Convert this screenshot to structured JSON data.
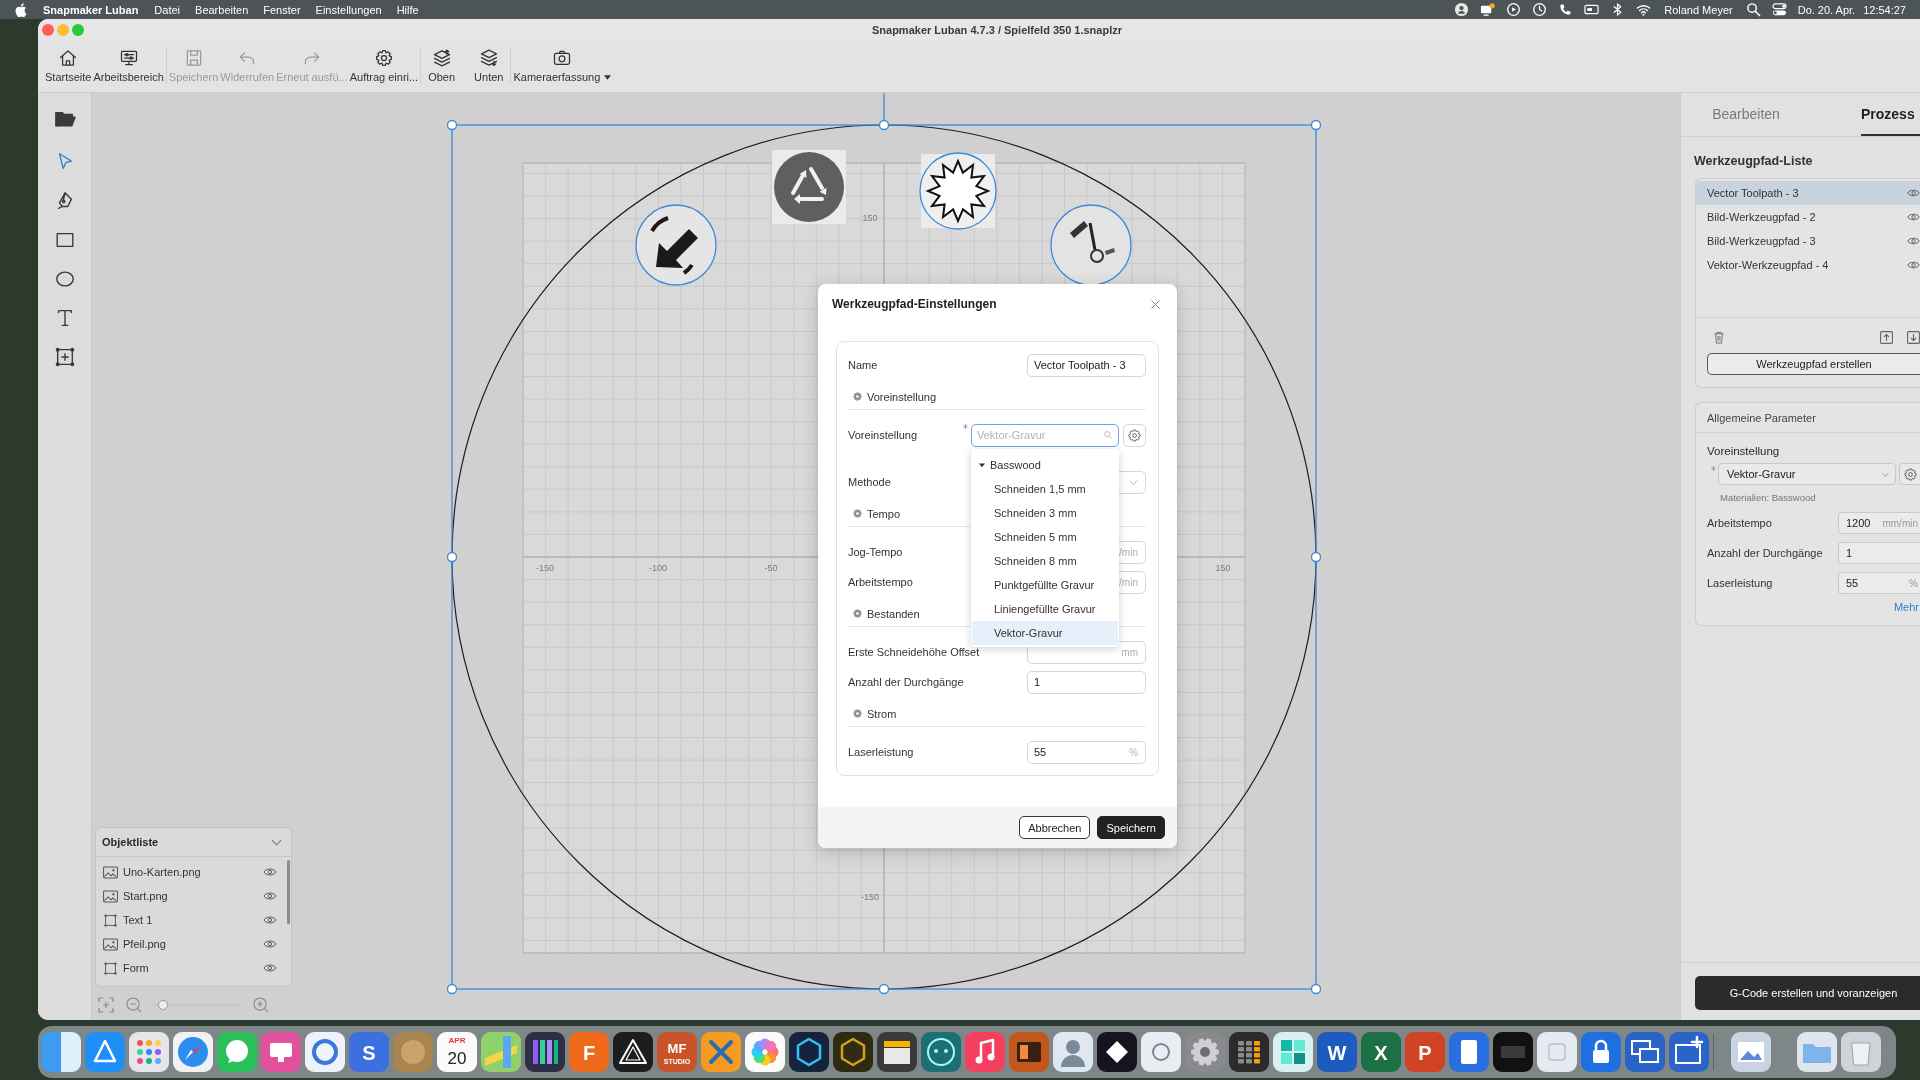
{
  "menu_bar": {
    "app_name": "Snapmaker Luban",
    "menus": [
      "Datei",
      "Bearbeiten",
      "Fenster",
      "Einstellungen",
      "Hilfe"
    ],
    "user": "Roland Meyer",
    "date": "Do. 20. Apr.",
    "time": "12:54:27"
  },
  "window": {
    "title": "Snapmaker Luban 4.7.3 / Spielfeld 350 1.snaplzr"
  },
  "toolbar": {
    "groups": [
      {
        "items": [
          {
            "label": "Startseite",
            "disabled": false,
            "dropdown": false
          },
          {
            "label": "Arbeitsbereich",
            "disabled": false,
            "dropdown": false
          }
        ]
      },
      {
        "items": [
          {
            "label": "Speichern",
            "disabled": true,
            "dropdown": false
          },
          {
            "label": "Widerrufen",
            "disabled": true,
            "dropdown": false
          },
          {
            "label": "Erneut ausfü...",
            "disabled": true,
            "dropdown": false
          },
          {
            "label": "Auftrag einri...",
            "disabled": false,
            "dropdown": false
          }
        ]
      },
      {
        "items": [
          {
            "label": "Oben",
            "disabled": false,
            "dropdown": false
          },
          {
            "label": "Unten",
            "disabled": false,
            "dropdown": false
          }
        ]
      },
      {
        "items": [
          {
            "label": "Kameraerfassung",
            "disabled": false,
            "dropdown": true
          }
        ]
      }
    ]
  },
  "tools": [
    {
      "selected": false
    },
    {
      "selected": true
    },
    {
      "selected": false
    },
    {
      "selected": false
    },
    {
      "selected": false
    },
    {
      "selected": false
    },
    {
      "selected": false
    }
  ],
  "canvas": {
    "x_axis_labels": [
      "-150",
      "-100",
      "-50",
      "150"
    ],
    "y_axis_labels": [
      "150",
      "-150"
    ]
  },
  "object_list": {
    "title": "Objektliste",
    "items": [
      {
        "name": "Uno-Karten.png",
        "kind": "image",
        "visible": true
      },
      {
        "name": "Start.png",
        "kind": "image",
        "visible": true
      },
      {
        "name": "Text 1",
        "kind": "vector",
        "visible": true
      },
      {
        "name": "Pfeil.png",
        "kind": "image",
        "visible": true
      },
      {
        "name": "Form",
        "kind": "vector",
        "visible": true
      }
    ]
  },
  "zoom_bar": {
    "level": 0.05
  },
  "dialog": {
    "title": "Werkzeugpfad-Einstellungen",
    "rows": [
      {
        "kind": "field",
        "label": "Name",
        "value": "Vector Toolpath - 3"
      },
      {
        "kind": "section",
        "label": "Voreinstellung"
      },
      {
        "kind": "preset",
        "label": "Voreinstellung",
        "required": true,
        "placeholder": "Vektor-Gravur"
      },
      {
        "kind": "select",
        "label": "Methode"
      },
      {
        "kind": "section",
        "label": "Tempo"
      },
      {
        "kind": "field",
        "label": "Jog-Tempo",
        "unit": "/min"
      },
      {
        "kind": "field",
        "label": "Arbeitstempo",
        "unit": "/min"
      },
      {
        "kind": "section",
        "label": "Bestanden"
      },
      {
        "kind": "field",
        "label": "Erste Schneidehöhe Offset",
        "unit": "mm"
      },
      {
        "kind": "field",
        "label": "Anzahl der Durchgänge",
        "value": "1"
      },
      {
        "kind": "section",
        "label": "Strom"
      },
      {
        "kind": "field",
        "label": "Laserleistung",
        "value": "55",
        "unit": "%"
      }
    ],
    "dropdown": {
      "group": "Basswood",
      "expanded": true,
      "options": [
        {
          "label": "Schneiden 1,5 mm",
          "selected": false
        },
        {
          "label": "Schneiden 3 mm",
          "selected": false
        },
        {
          "label": "Schneiden 5 mm",
          "selected": false
        },
        {
          "label": "Schneiden 8 mm",
          "selected": false
        },
        {
          "label": "Punktgefüllte Gravur",
          "selected": false
        },
        {
          "label": "Liniengefüllte Gravur",
          "selected": false
        },
        {
          "label": "Vektor-Gravur",
          "selected": true
        }
      ]
    },
    "buttons": [
      {
        "label": "Abbrechen",
        "primary": false
      },
      {
        "label": "Speichern",
        "primary": true
      }
    ]
  },
  "side_panel": {
    "tabs": [
      {
        "label": "Bearbeiten",
        "selected": false
      },
      {
        "label": "Prozess",
        "selected": true
      }
    ],
    "list_title": "Werkzeugpfad-Liste",
    "toolpaths": [
      {
        "name": "Vector Toolpath - 3",
        "selected": true,
        "visible": true
      },
      {
        "name": "Bild-Werkzeugpfad - 2",
        "selected": false,
        "visible": true
      },
      {
        "name": "Bild-Werkzeugpfad - 3",
        "selected": false,
        "visible": true
      },
      {
        "name": "Vektor-Werkzeugpfad - 4",
        "selected": false,
        "visible": true
      }
    ],
    "create_button": "Werkzeugpfad erstellen",
    "params_title": "Allgemeine Parameter",
    "preset_label": "Voreinstellung",
    "preset_required": true,
    "preset_value": "Vektor-Gravur",
    "material_note": "Materialien: Basswood",
    "fields": [
      {
        "label": "Arbeitstempo",
        "value": "1200",
        "unit": "mm/min"
      },
      {
        "label": "Anzahl der Durchgänge",
        "value": "1"
      },
      {
        "label": "Laserleistung",
        "value": "55",
        "unit": "%"
      }
    ],
    "more_link": "Mehr",
    "generate_button": "G-Code erstellen und voranzeigen"
  },
  "dock": {
    "calendar_month": "APR",
    "calendar_day": "20",
    "tile_letters": [
      "S",
      "F",
      "MF",
      "W",
      "X",
      "P"
    ],
    "studio_label": "STUDIO"
  }
}
